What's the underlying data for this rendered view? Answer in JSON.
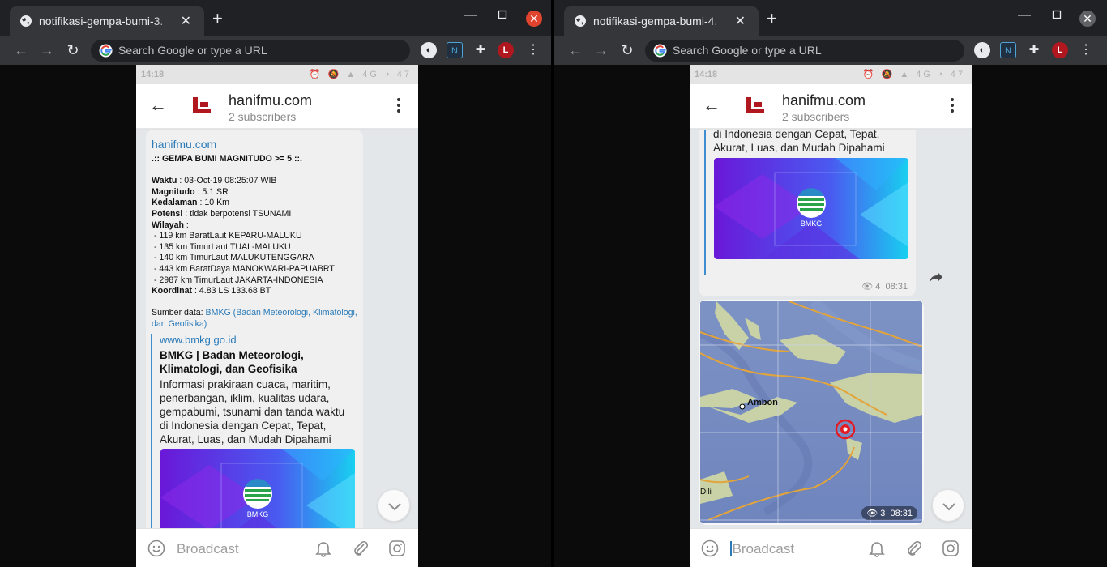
{
  "windows": [
    {
      "tab_title": "notifikasi-gempa-bumi-3.",
      "omnibox_placeholder": "Search Google or type a URL"
    },
    {
      "tab_title": "notifikasi-gempa-bumi-4.",
      "omnibox_placeholder": "Search Google or type a URL"
    }
  ],
  "phone": {
    "status_time": "14:18",
    "status_network": "4G",
    "status_battery": "47",
    "channel_name": "hanifmu.com",
    "subscribers": "2 subscribers",
    "input_placeholder": "Broadcast"
  },
  "message1": {
    "sender": "hanifmu.com",
    "heading": ".:: GEMPA BUMI MAGNITUDO >= 5 ::.",
    "waktu_label": "Waktu",
    "waktu": " : 03-Oct-19 08:25:07 WIB",
    "magnitudo_label": "Magnitudo",
    "magnitudo": " : 5.1 SR",
    "kedalaman_label": "Kedalaman",
    "kedalaman": " : 10 Km",
    "potensi_label": "Potensi",
    "potensi": " : tidak berpotensi TSUNAMI",
    "wilayah_label": "Wilayah",
    "wilayah_sep": " :",
    "wilayah": [
      " - 119 km BaratLaut KEPARU-MALUKU",
      " - 135 km TimurLaut TUAL-MALUKU",
      " - 140 km TimurLaut MALUKUTENGGARA",
      " - 443 km BaratDaya MANOKWARI-PAPUABRT",
      " - 2987 km TimurLaut JAKARTA-INDONESIA"
    ],
    "koordinat_label": "Koordinat",
    "koordinat": " : 4.83 LS 133.68 BT",
    "sumber_prefix": "Sumber data: ",
    "sumber_link": "BMKG (Badan Meteorologi, Klimatologi, dan Geofisika)",
    "preview_url": "www.bmkg.go.id",
    "preview_title": "BMKG | Badan Meteorologi, Klimatologi, dan Geofisika",
    "preview_desc": "Informasi prakiraan cuaca, maritim, penerbangan, iklim, kualitas udara, gempabumi, tsunami dan tanda waktu di Indonesia dengan Cepat, Tepat, Akurat, Luas, dan Mudah Dipahami",
    "image_label": "BMKG"
  },
  "message2": {
    "preview_desc_tail": "gempabumi, tsunami dan tanda waktu di Indonesia dengan Cepat, Tepat, Akurat, Luas, dan Mudah Dipahami",
    "image_label": "BMKG",
    "views": "4",
    "time": "08:31"
  },
  "message3": {
    "map_label_ambon": "Ambon",
    "map_label_dili": "Dili",
    "views": "3",
    "time": "08:31"
  }
}
